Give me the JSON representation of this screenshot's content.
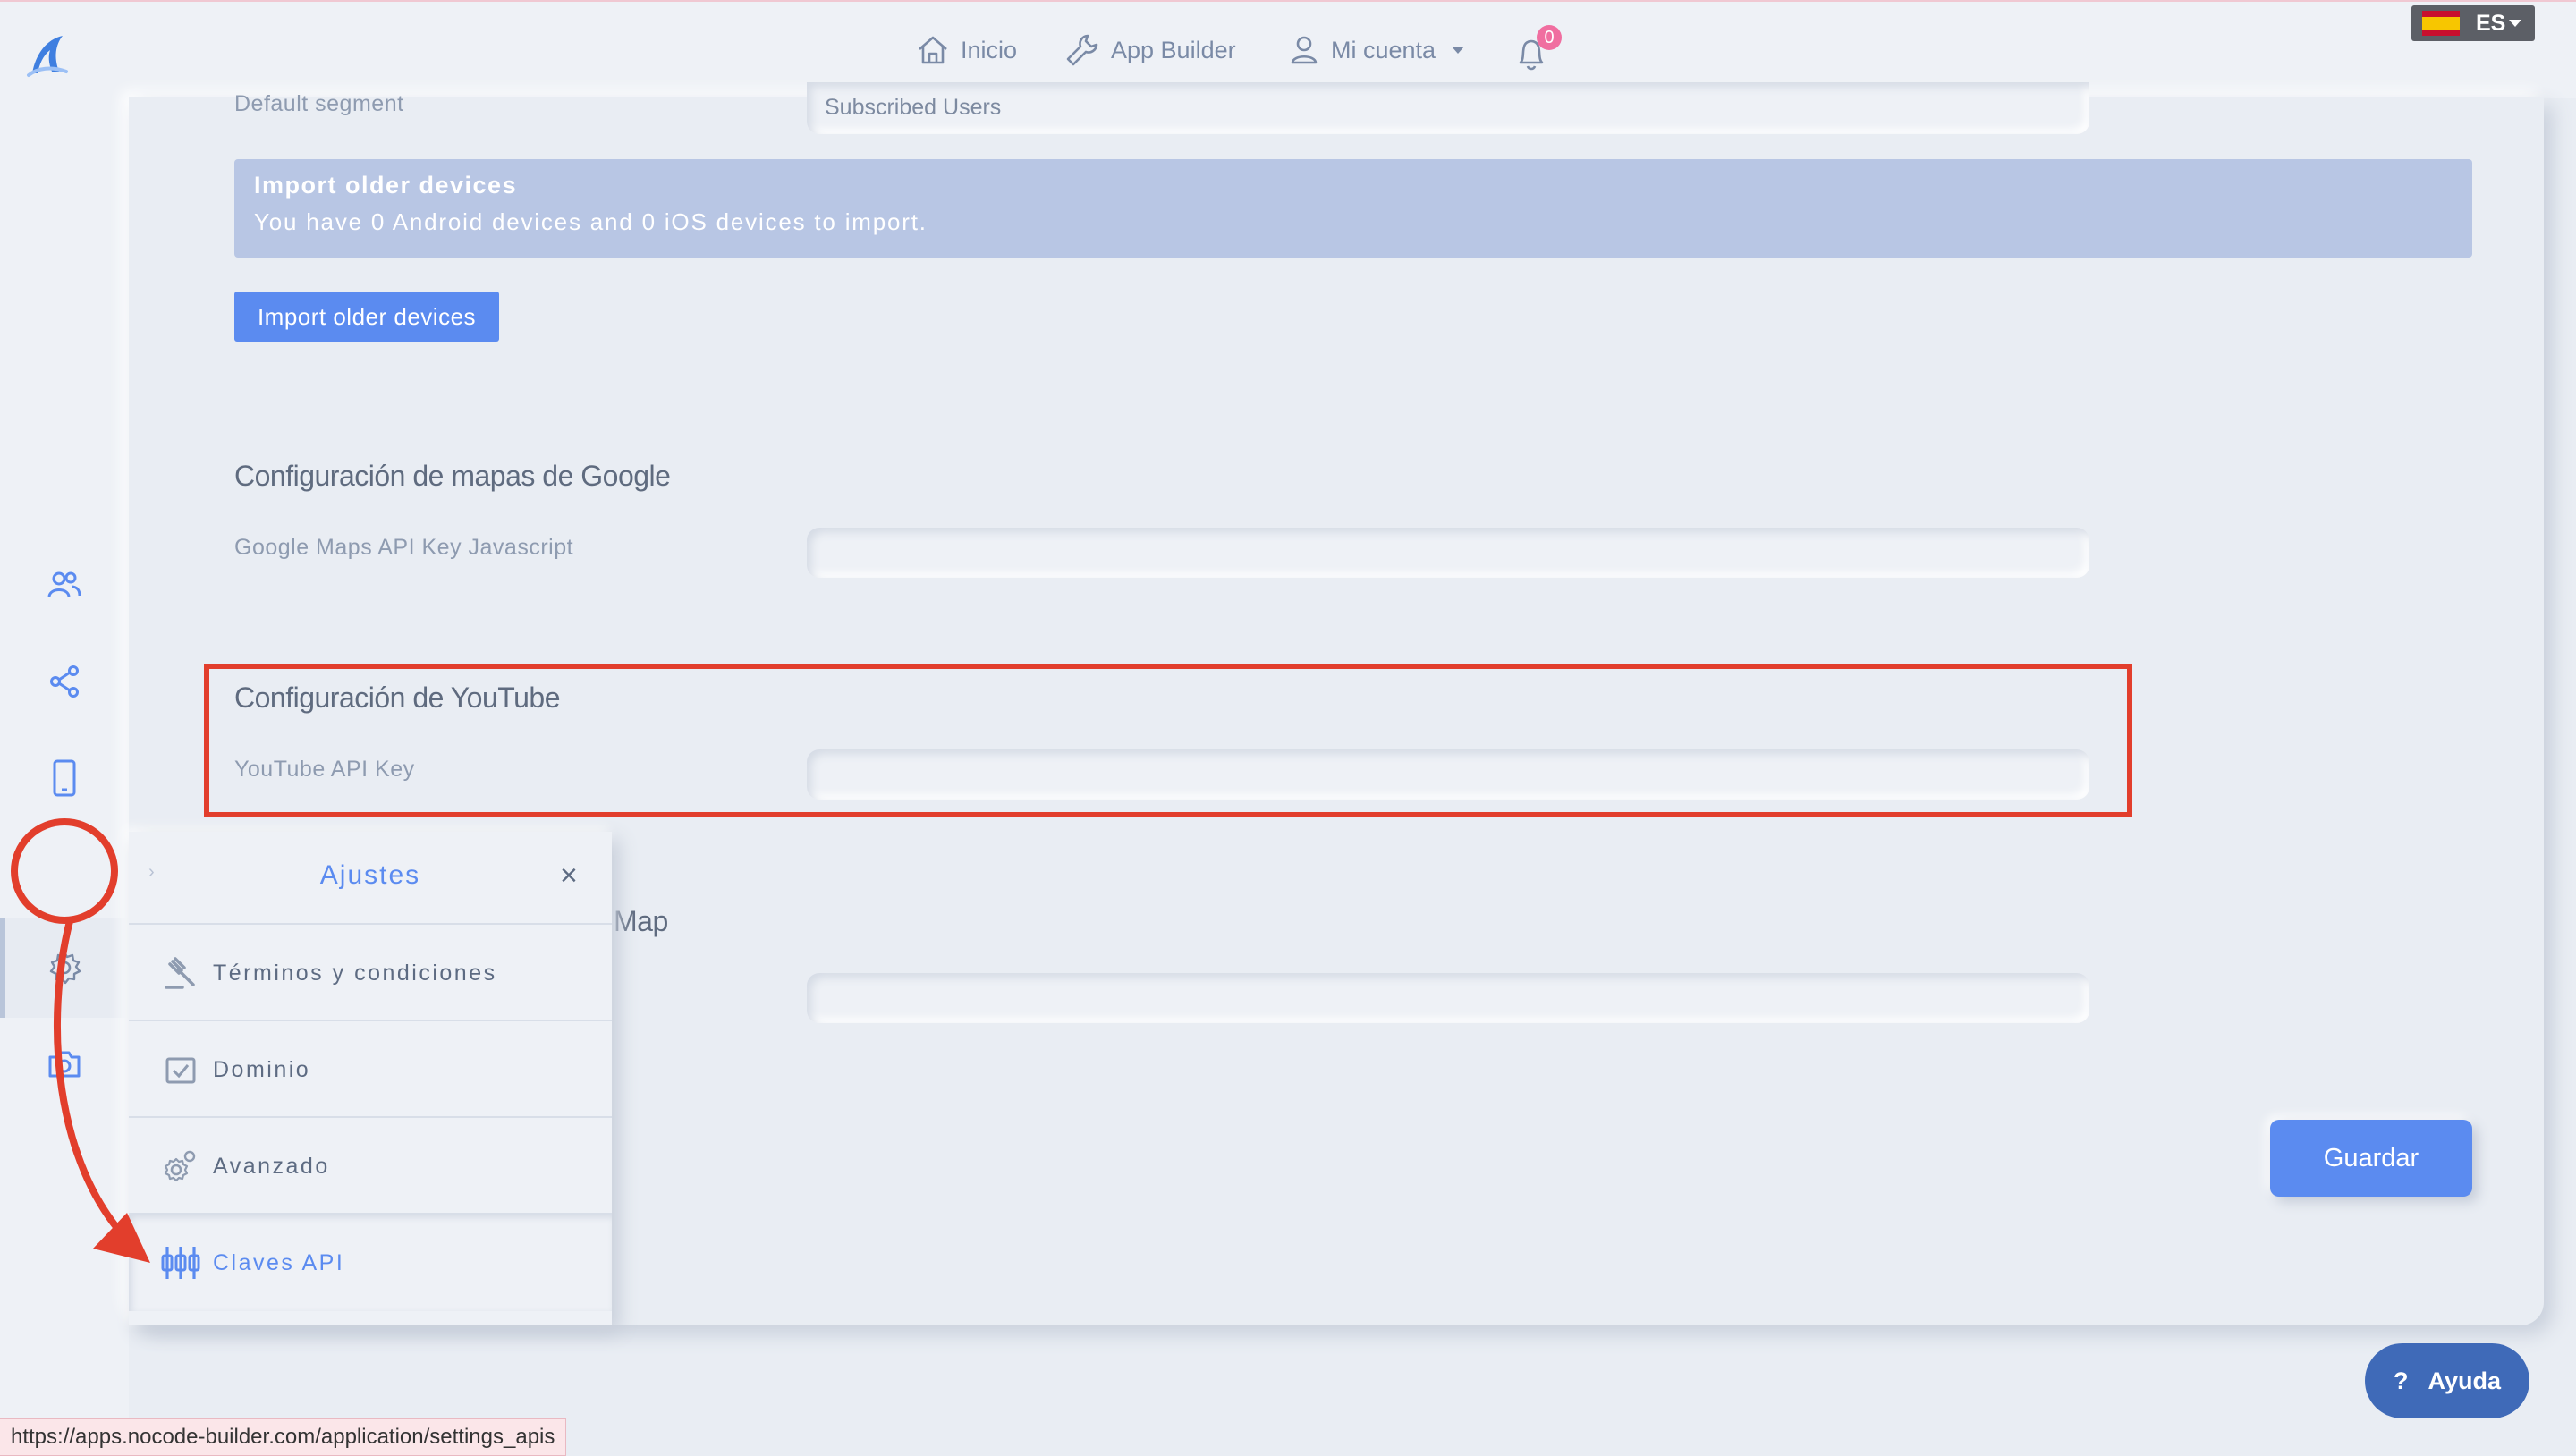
{
  "nav": {
    "inicio": "Inicio",
    "app_builder": "App Builder",
    "mi_cuenta": "Mi cuenta",
    "notifications_count": "0"
  },
  "lang": {
    "code": "ES"
  },
  "settings": {
    "default_segment_label": "Default segment",
    "default_segment_value": "Subscribed Users",
    "import_alert_title": "Import older devices",
    "import_alert_body": "You have 0 Android devices and 0 iOS devices to import.",
    "import_button": "Import older devices",
    "google_maps_heading": "Configuración de mapas de Google",
    "google_maps_label": "Google Maps API Key Javascript",
    "google_maps_value": "",
    "youtube_heading": "Configuración de YouTube",
    "youtube_label": "YouTube API Key",
    "youtube_value": "",
    "partial_heading": "Map",
    "third_field_value": "",
    "save_button": "Guardar"
  },
  "flyout": {
    "title": "Ajustes",
    "items": [
      {
        "label": "Términos y condiciones",
        "icon": "gavel-icon"
      },
      {
        "label": "Dominio",
        "icon": "calendar-check-icon"
      },
      {
        "label": "Avanzado",
        "icon": "gears-icon"
      },
      {
        "label": "Claves API",
        "icon": "keys-icon"
      }
    ]
  },
  "help_button": "Ayuda",
  "status_url": "https://apps.nocode-builder.com/application/settings_apis",
  "colors": {
    "accent": "#5b8bf0",
    "annotation": "#e23e2c",
    "background": "#e9edf3"
  }
}
